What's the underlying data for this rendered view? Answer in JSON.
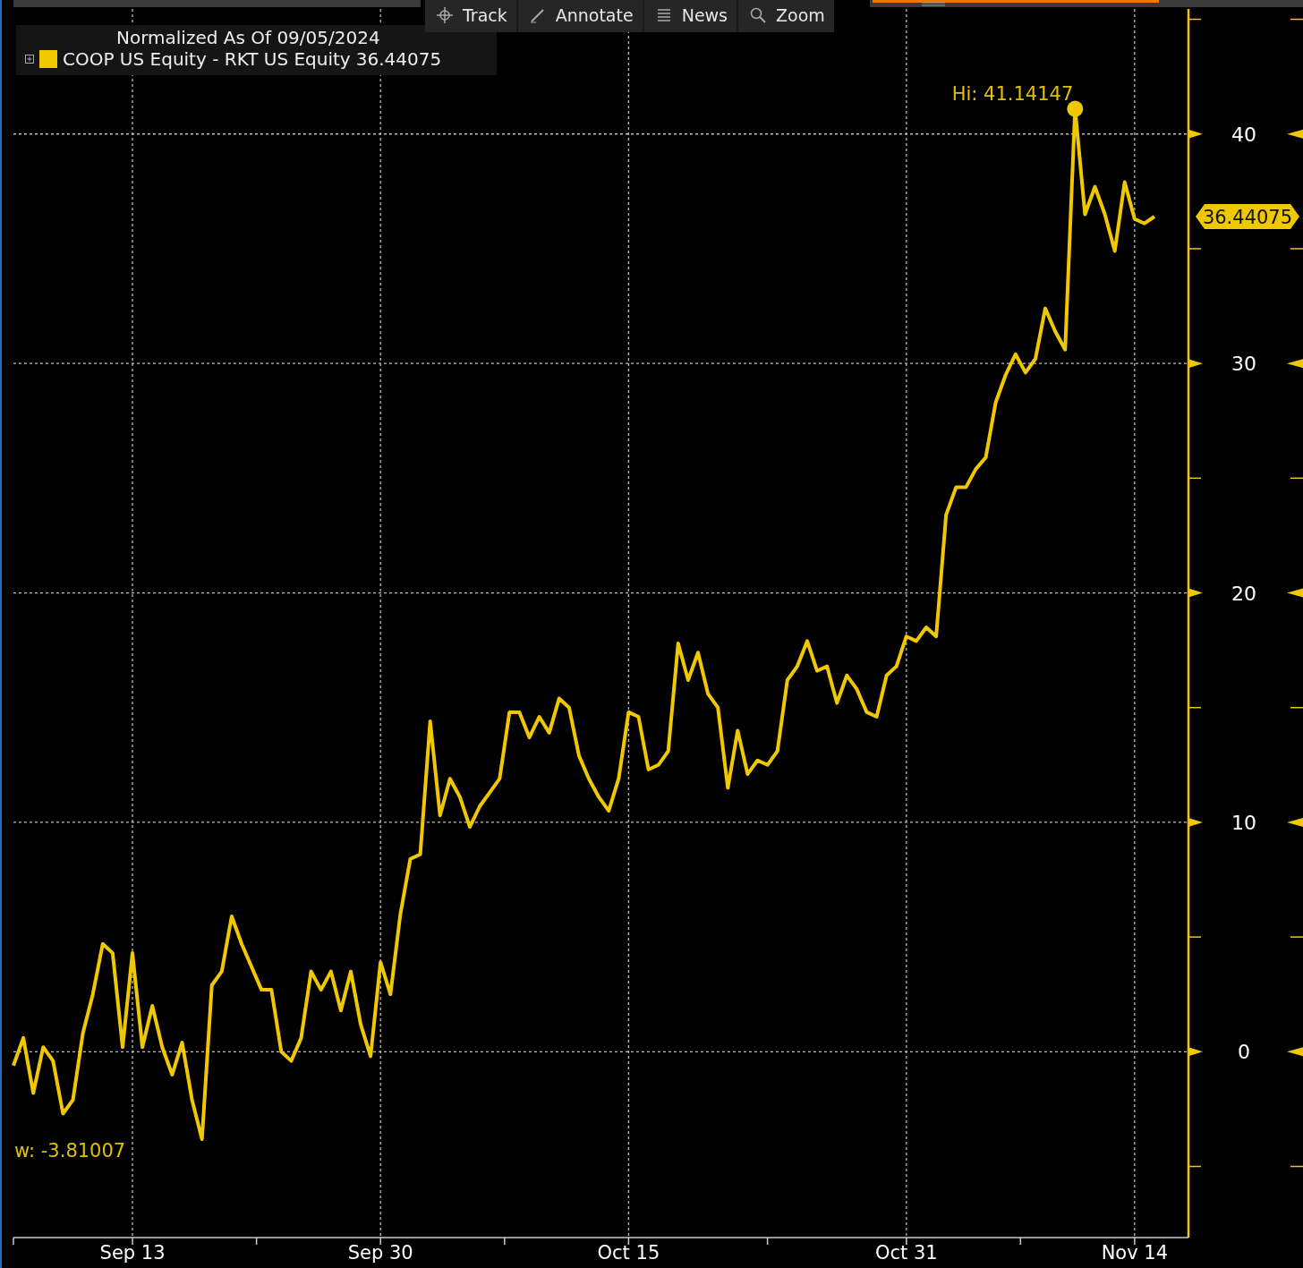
{
  "toolbar": [
    {
      "kind": "track",
      "label": "Track"
    },
    {
      "kind": "annotate",
      "label": "Annotate"
    },
    {
      "kind": "news",
      "label": "News"
    },
    {
      "kind": "zoom",
      "label": "Zoom"
    }
  ],
  "legend": {
    "title": "Normalized As Of 09/05/2024",
    "value": "36.44075"
  },
  "chart": {
    "last_value": "36.44075",
    "chart_data": {
      "type": "line",
      "grid": true,
      "ylim": [
        -8.1,
        45.45
      ],
      "yticks": [
        0,
        10,
        20,
        30,
        40
      ],
      "categories": [
        null,
        null,
        null,
        null,
        null,
        null,
        null,
        null,
        null,
        null,
        null,
        null,
        "Sep 13",
        null,
        null,
        null,
        null,
        null,
        null,
        null,
        null,
        null,
        null,
        null,
        null,
        null,
        null,
        null,
        null,
        null,
        null,
        null,
        null,
        null,
        null,
        null,
        null,
        "Sep 30",
        null,
        null,
        null,
        null,
        null,
        null,
        null,
        null,
        null,
        null,
        null,
        null,
        null,
        null,
        null,
        null,
        null,
        null,
        null,
        null,
        null,
        null,
        null,
        null,
        "Oct 15",
        null,
        null,
        null,
        null,
        null,
        null,
        null,
        null,
        null,
        null,
        null,
        null,
        null,
        null,
        null,
        null,
        null,
        null,
        null,
        null,
        null,
        null,
        null,
        null,
        null,
        null,
        null,
        "Oct 31",
        null,
        null,
        null,
        null,
        null,
        null,
        null,
        null,
        null,
        null,
        null,
        null,
        null,
        null,
        null,
        null,
        null,
        null,
        null,
        null,
        null,
        null,
        "Nov 14",
        null,
        null
      ],
      "series": [
        {
          "name": "COOP US Equity - RKT US Equity",
          "color": "#f0c800",
          "values": [
            -0.6,
            0.6,
            -1.8,
            0.2,
            -0.4,
            -2.7,
            -2.1,
            0.8,
            2.5,
            4.7,
            4.3,
            0.2,
            4.3,
            0.2,
            2,
            0.2,
            -1,
            0.4,
            -2.1,
            -3.81,
            2.9,
            3.5,
            5.9,
            4.7,
            3.7,
            2.7,
            2.7,
            0,
            -0.4,
            0.6,
            3.5,
            2.7,
            3.5,
            1.8,
            3.5,
            1.2,
            -0.2,
            3.9,
            2.5,
            6,
            8.4,
            8.6,
            14.4,
            10.3,
            11.9,
            11.1,
            9.8,
            10.7,
            11.3,
            11.9,
            14.8,
            14.8,
            13.7,
            14.6,
            13.9,
            15.4,
            15,
            12.9,
            11.9,
            11.1,
            10.5,
            11.9,
            14.8,
            14.6,
            12.3,
            12.5,
            13.1,
            17.8,
            16.2,
            17.4,
            15.6,
            15,
            11.5,
            14,
            12.1,
            12.7,
            12.5,
            13.1,
            16.2,
            16.8,
            17.9,
            16.6,
            16.8,
            15.2,
            16.4,
            15.8,
            14.8,
            14.6,
            16.4,
            16.8,
            18.1,
            17.9,
            18.5,
            18.1,
            23.4,
            24.6,
            24.6,
            25.4,
            25.9,
            28.3,
            29.5,
            30.4,
            29.6,
            30.2,
            32.4,
            31.4,
            30.6,
            41.1,
            36.5,
            37.7,
            36.5,
            34.9,
            37.9,
            36.3,
            36.1,
            36.4
          ]
        }
      ],
      "annotations": [
        "Hi: 41.14147",
        "w: -3.81007"
      ]
    }
  }
}
